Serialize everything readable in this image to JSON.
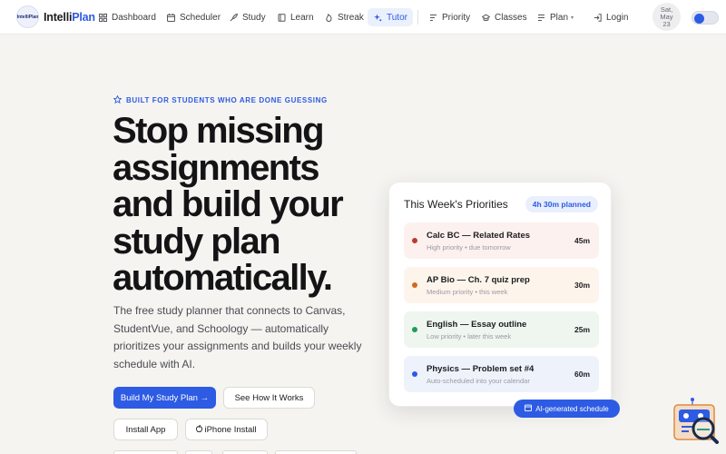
{
  "brand": {
    "logo_text": "IntelliPlan",
    "name_part1": "Intelli",
    "name_part2": "Plan"
  },
  "nav": {
    "items": [
      {
        "label": "Dashboard",
        "icon": "dashboard-icon"
      },
      {
        "label": "Scheduler",
        "icon": "calendar-icon"
      },
      {
        "label": "Study",
        "icon": "rocket-icon"
      },
      {
        "label": "Learn",
        "icon": "book-icon"
      },
      {
        "label": "Streak",
        "icon": "flame-icon"
      },
      {
        "label": "Tutor",
        "icon": "sparkle-icon",
        "active": true
      },
      {
        "label": "Priority",
        "icon": "priority-icon"
      },
      {
        "label": "Classes",
        "icon": "classes-icon"
      },
      {
        "label": "Plan",
        "icon": "plan-icon"
      },
      {
        "label": "Login",
        "icon": "login-icon"
      }
    ],
    "date": {
      "day": "Sat,",
      "month": "May",
      "num": "23"
    }
  },
  "hero": {
    "eyebrow": "BUILT FOR STUDENTS WHO ARE DONE GUESSING",
    "headline": "Stop missing assignments and build your study plan automatically.",
    "subtext": "The free study planner that connects to Canvas, StudentVue, and Schoology — automatically prioritizes your assignments and builds your weekly schedule with AI.",
    "buttons": {
      "primary": "Build My Study Plan →",
      "how": "See How It Works",
      "install": "Install App",
      "iphone": "iPhone Install"
    }
  },
  "card": {
    "title": "This Week's Priorities",
    "planned": "4h 30m planned",
    "items": [
      {
        "title": "Calc BC — Related Rates",
        "sub": "High priority • due tomorrow",
        "mins": "45m",
        "color": "#c0392b",
        "bg": "#fdf1ef"
      },
      {
        "title": "AP Bio — Ch. 7 quiz prep",
        "sub": "Medium priority • this week",
        "mins": "30m",
        "color": "#d2691e",
        "bg": "#fdf5ec"
      },
      {
        "title": "English — Essay outline",
        "sub": "Low priority • later this week",
        "mins": "25m",
        "color": "#1f9d55",
        "bg": "#eef6ef"
      },
      {
        "title": "Physics — Problem set #4",
        "sub": "Auto-scheduled into your calendar",
        "mins": "60m",
        "color": "#2d5be3",
        "bg": "#eef2fb"
      }
    ],
    "ai_badge": "AI-generated schedule"
  },
  "colors": {
    "accent": "#2d5be3",
    "text": "#1c1c1f",
    "background": "#f5f4f1"
  }
}
